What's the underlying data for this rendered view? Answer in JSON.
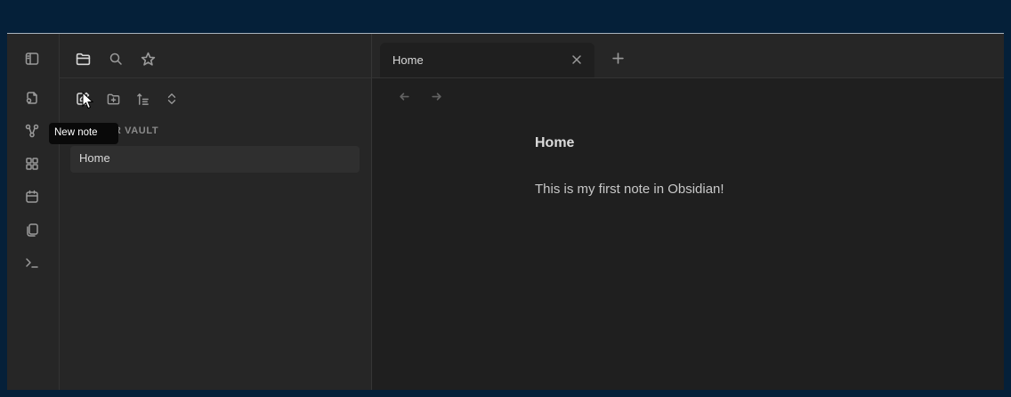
{
  "tabs": [
    {
      "label": "Home",
      "active": true
    }
  ],
  "sidebar": {
    "vault_label": "ER VAULT",
    "files": [
      {
        "name": "Home"
      }
    ],
    "tooltip": "New note",
    "nav_icons": [
      "files-icon",
      "search-icon",
      "bookmark-icon"
    ],
    "actions": [
      "new-note-icon",
      "new-folder-icon",
      "sort-icon",
      "collapse-icon"
    ]
  },
  "ribbon": {
    "icons": [
      "sidebar-toggle-icon",
      "open-quick-switcher-icon",
      "graph-view-icon",
      "canvas-icon",
      "daily-note-icon",
      "templates-icon",
      "command-palette-icon"
    ]
  },
  "note": {
    "title": "Home",
    "body": "This is my first note in Obsidian!"
  }
}
